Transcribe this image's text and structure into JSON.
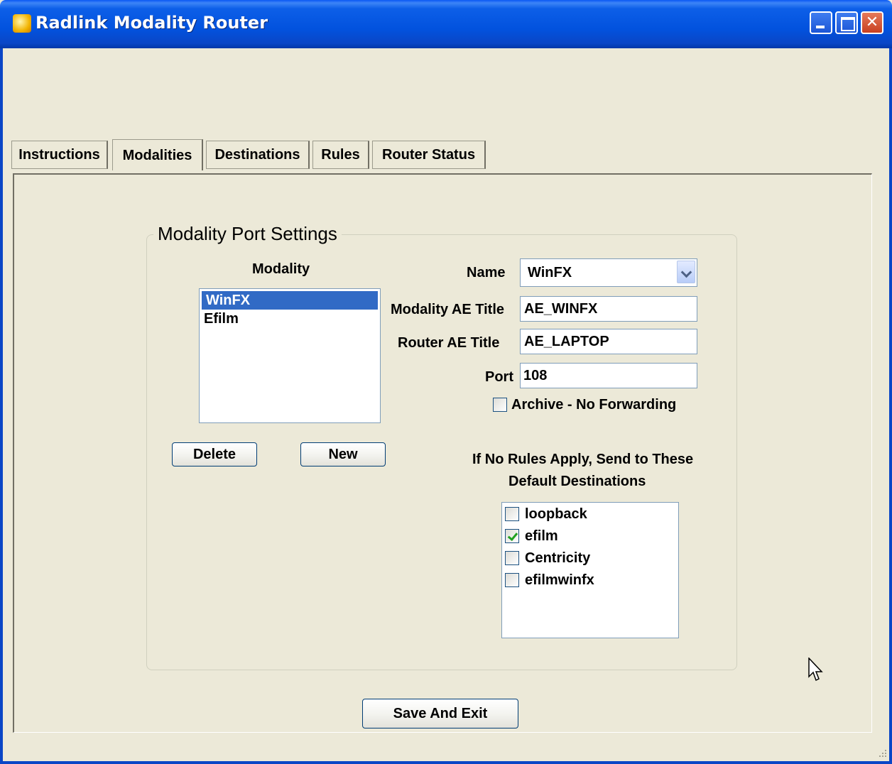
{
  "window": {
    "title": "Radlink Modality Router"
  },
  "tabs": [
    {
      "label": "Instructions"
    },
    {
      "label": "Modalities",
      "active": true
    },
    {
      "label": "Destinations"
    },
    {
      "label": "Rules"
    },
    {
      "label": "Router Status"
    }
  ],
  "group": {
    "title": "Modality Port Settings"
  },
  "modality_list": {
    "header": "Modality",
    "items": [
      "WinFX",
      "Efilm"
    ],
    "selected": "WinFX"
  },
  "buttons": {
    "delete": "Delete",
    "new": "New",
    "save_exit": "Save And Exit"
  },
  "form": {
    "name_label": "Name",
    "name_value": "WinFX",
    "modality_ae_label": "Modality AE Title",
    "modality_ae_value": "AE_WINFX",
    "router_ae_label": "Router AE Title",
    "router_ae_value": "AE_LAPTOP",
    "port_label": "Port",
    "port_value": "108",
    "archive_label": "Archive - No Forwarding",
    "archive_checked": false
  },
  "defaults": {
    "heading_line1": "If No Rules Apply, Send to These",
    "heading_line2": "Default Destinations",
    "items": [
      {
        "label": "loopback",
        "checked": false
      },
      {
        "label": "efilm",
        "checked": true
      },
      {
        "label": "Centricity",
        "checked": false
      },
      {
        "label": "efilmwinfx",
        "checked": false
      }
    ]
  },
  "colors": {
    "titlebar": "#0252de",
    "selection": "#316ac5",
    "check": "#21a121",
    "window_bg": "#ece9d8"
  },
  "icons": [
    "app-icon",
    "minimize-icon",
    "maximize-icon",
    "close-icon",
    "chevron-down-icon",
    "mouse-cursor-icon",
    "resize-grip-icon"
  ]
}
